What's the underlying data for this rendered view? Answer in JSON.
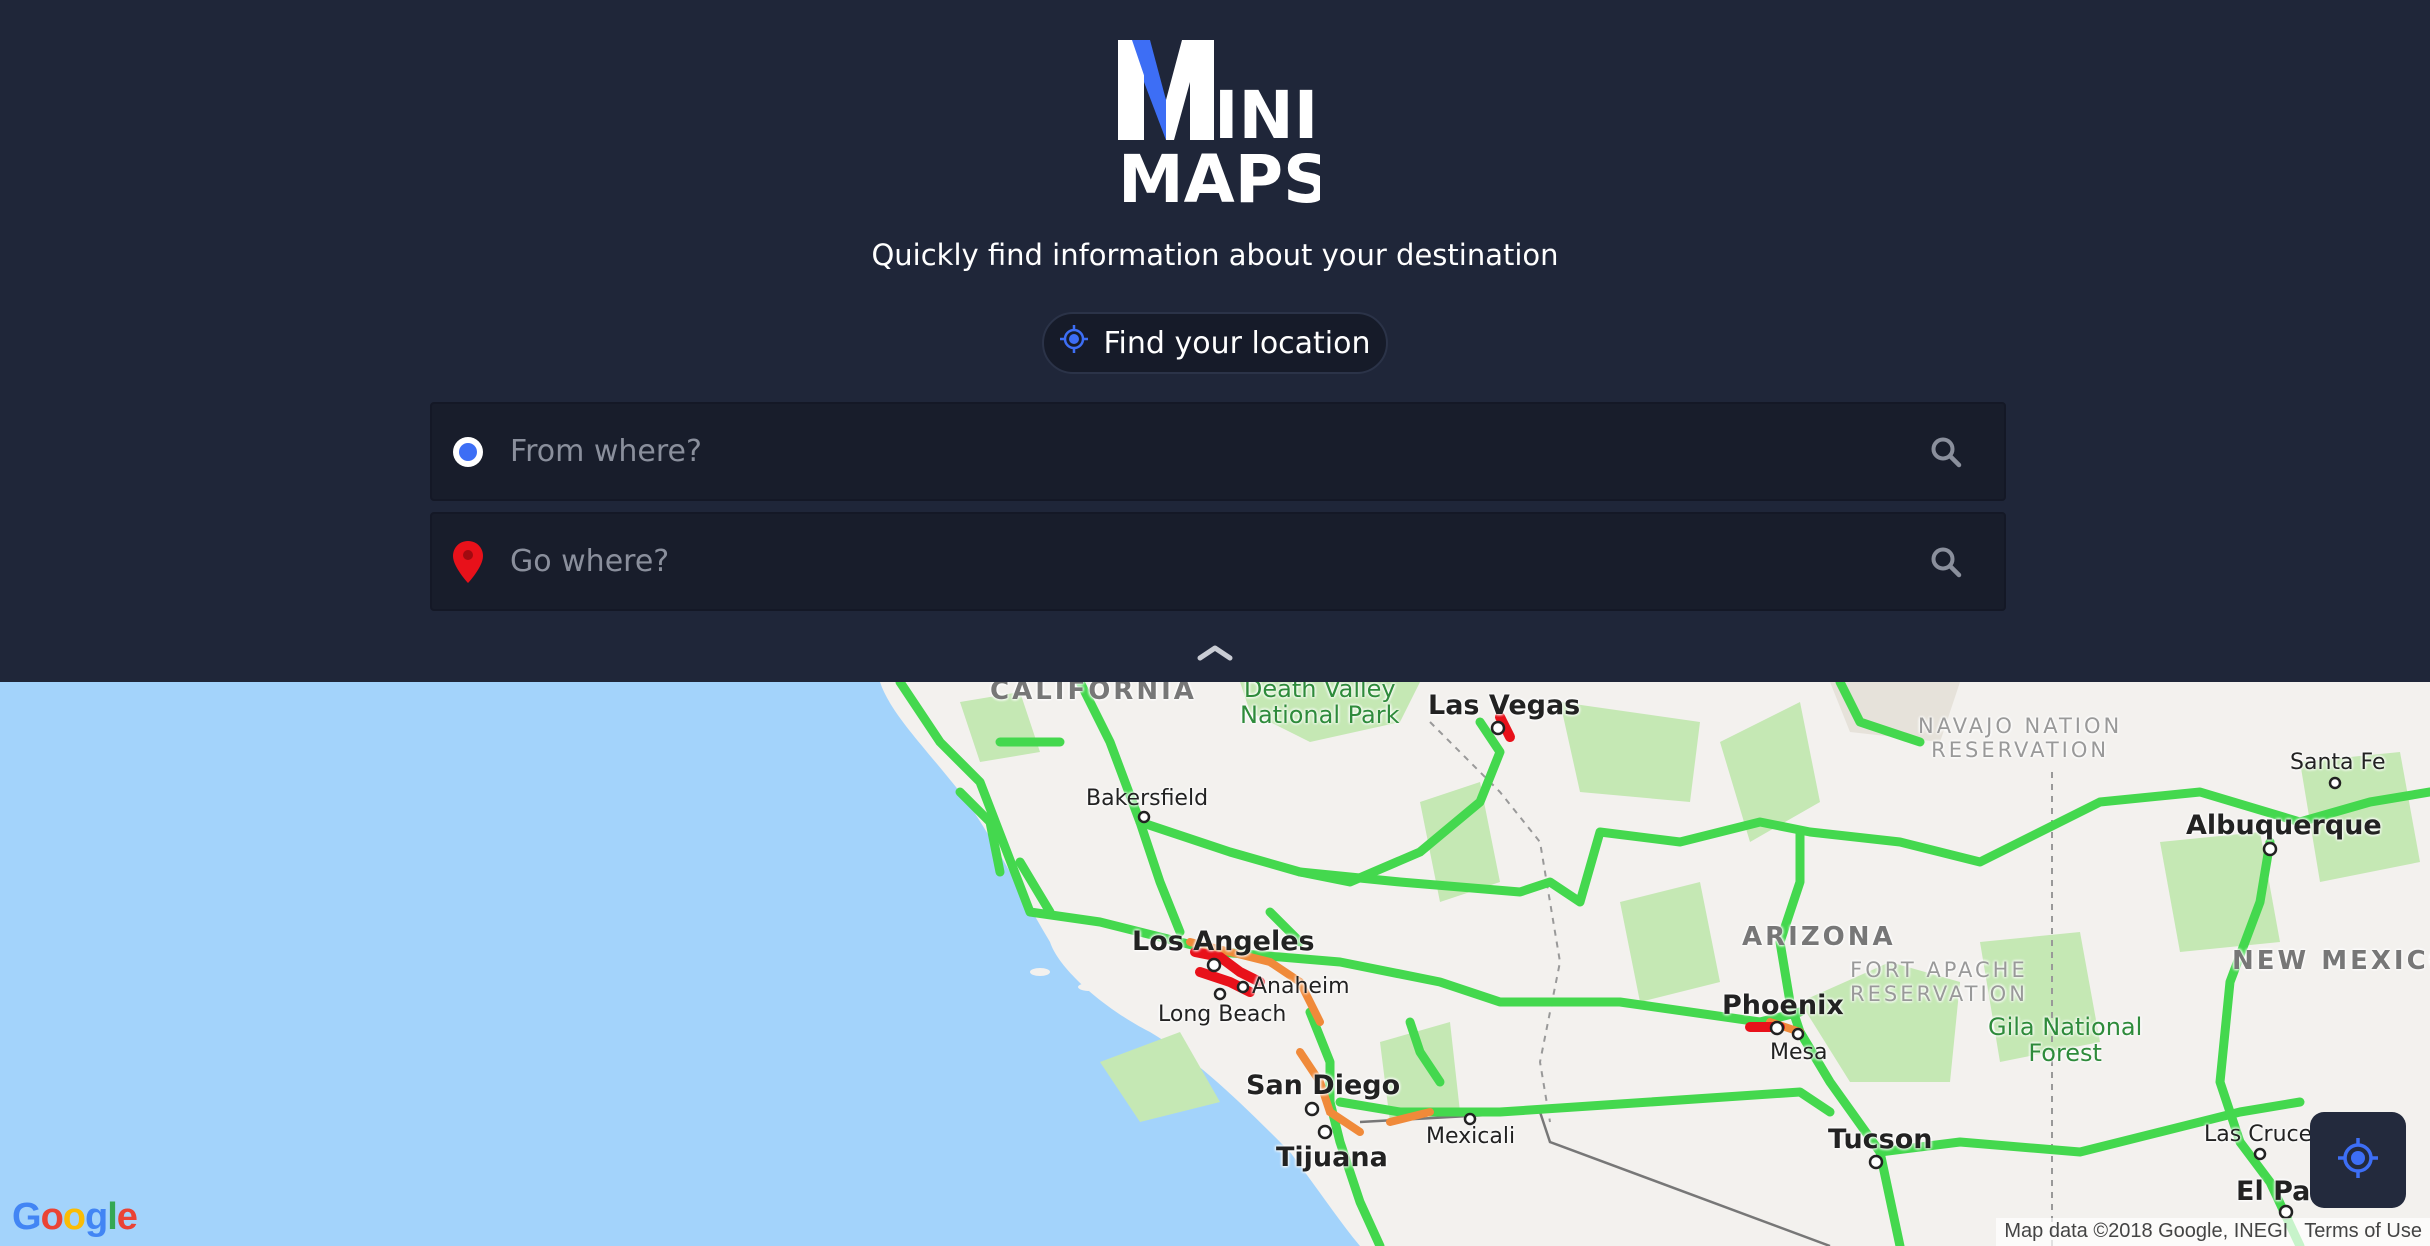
{
  "logo": {
    "line1": "INI",
    "letter_m": "M",
    "line2": "MAPS",
    "accent_color": "#3d6ef5"
  },
  "tagline": "Quickly find information about your destination",
  "find_location": {
    "label": "Find your location",
    "icon": "crosshair-icon"
  },
  "search": {
    "from": {
      "placeholder": "From where?",
      "value": "",
      "icon": "origin-dot-icon"
    },
    "to": {
      "placeholder": "Go where?",
      "value": "",
      "icon": "map-pin-icon"
    }
  },
  "collapse_icon": "chevron-up-icon",
  "map": {
    "labels": {
      "california": "CALIFORNIA",
      "death_valley": "Death Valley\nNational Park",
      "las_vegas": "Las Vegas",
      "bakersfield": "Bakersfield",
      "navajo": "NAVAJO NATION\nRESERVATION",
      "santa_fe": "Santa Fe",
      "albuquerque": "Albuquerque",
      "arizona": "ARIZONA",
      "new_mexico": "NEW MEXICO",
      "los_angeles": "Los Angeles",
      "anaheim": "Anaheim",
      "long_beach": "Long Beach",
      "fort_apache": "FORT APACHE\nRESERVATION",
      "phoenix": "Phoenix",
      "mesa": "Mesa",
      "gila": "Gila National\nForest",
      "san_diego": "San Diego",
      "mexicali": "Mexicali",
      "tijuana": "Tijuana",
      "tucson": "Tucson",
      "las_cruces": "Las Cruces",
      "el_paso": "El Pas"
    },
    "google_logo": "Google",
    "attribution": "Map data ©2018 Google, INEGI",
    "terms": "Terms of Use",
    "colors": {
      "water": "#a3d3fb",
      "land": "#f3f1ee",
      "park": "#c5e8b4",
      "traffic_free": "#44d84e",
      "traffic_slow": "#f08a3a",
      "traffic_jam": "#e8111a"
    }
  },
  "locate_button": {
    "icon": "my-location-icon"
  }
}
